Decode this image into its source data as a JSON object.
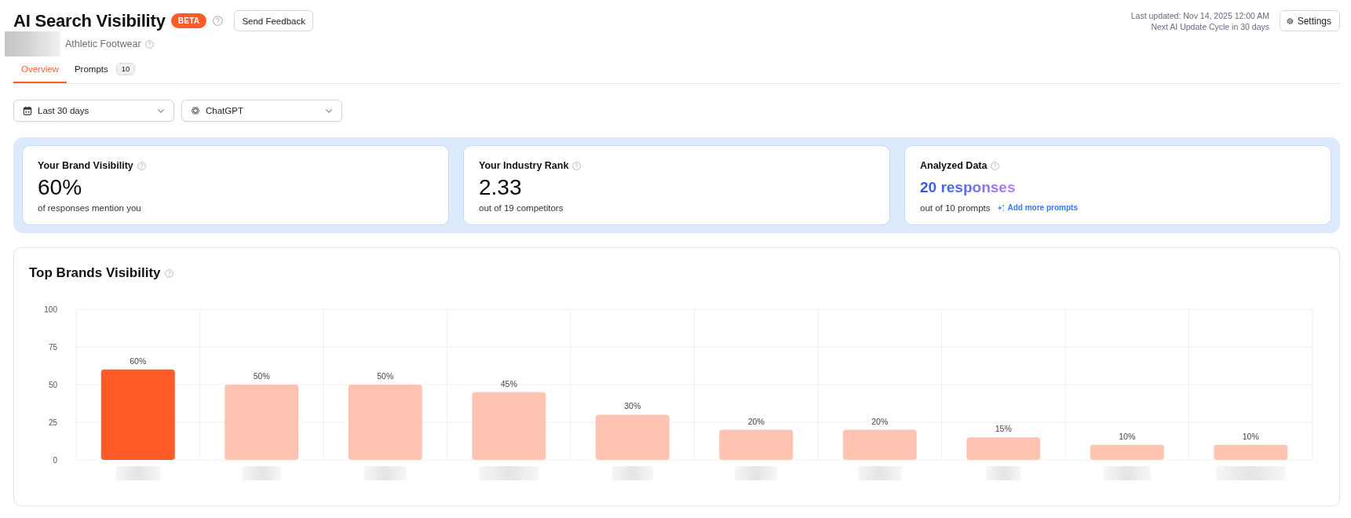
{
  "header": {
    "title": "AI Search Visibility",
    "badge": "BETA",
    "feedback_button": "Send Feedback",
    "subtitle": "Athletic Footwear",
    "last_updated": "Last updated: Nov 14, 2025 12:00 AM",
    "next_update": "Next AI Update Cycle in 30 days",
    "settings_button": "Settings"
  },
  "tabs": [
    {
      "label": "Overview",
      "selected": true
    },
    {
      "label": "Prompts",
      "count": "10",
      "selected": false
    }
  ],
  "filters": [
    {
      "kind": "date",
      "value": "Last 30 days"
    },
    {
      "kind": "model",
      "value": "ChatGPT"
    }
  ],
  "metrics": [
    {
      "kind": "plain",
      "title": "Your Brand Visibility",
      "value": "60%",
      "caption": "of responses mention you"
    },
    {
      "kind": "plain",
      "title": "Your Industry Rank",
      "value": "2.33",
      "caption": "out of 19 competitors"
    },
    {
      "kind": "gradient",
      "title": "Analyzed Data",
      "value": "20 responses",
      "caption": "out of 10 prompts",
      "link": "Add more prompts"
    }
  ],
  "chart_card": {
    "title": "Top Brands Visibility",
    "chart_data": {
      "type": "bar",
      "values": [
        60,
        50,
        50,
        45,
        30,
        20,
        20,
        15,
        10,
        10
      ],
      "value_labels": [
        "60%",
        "50%",
        "50%",
        "45%",
        "30%",
        "20%",
        "20%",
        "15%",
        "10%",
        "10%"
      ],
      "colors": [
        "#ff5c2a",
        "#fec3b1",
        "#fec3b1",
        "#fec3b1",
        "#fec3b1",
        "#fec3b1",
        "#fec3b1",
        "#fec3b1",
        "#fec3b1",
        "#fec3b1"
      ],
      "ylim": [
        0,
        100
      ],
      "yticks": [
        0,
        25,
        50,
        75,
        100
      ],
      "grid": true
    }
  }
}
